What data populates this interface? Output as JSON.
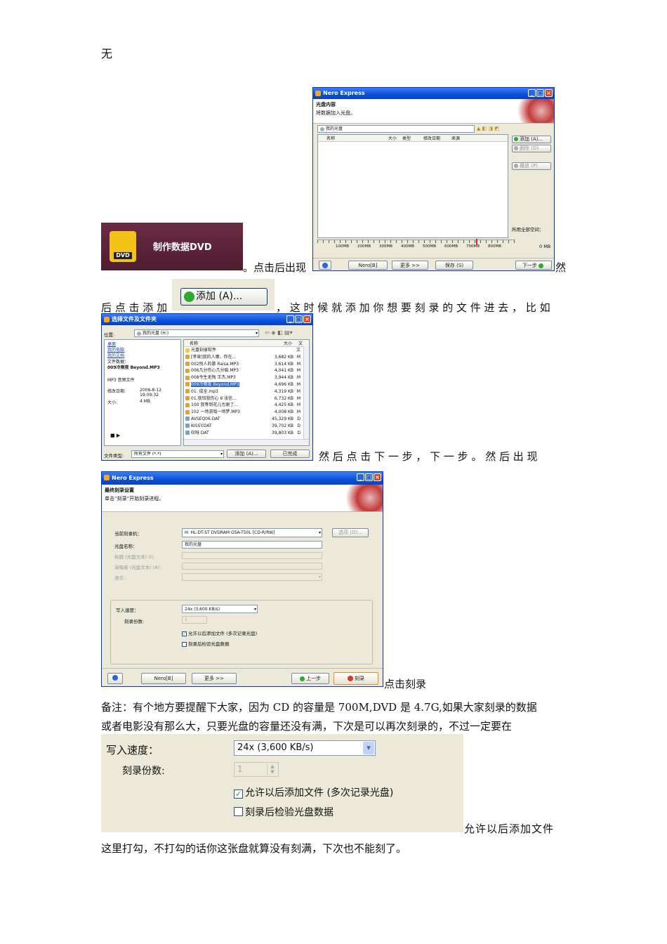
{
  "doc": {
    "line_top": "无",
    "after_dvd": "。点击后出现",
    "after_nero1": "然",
    "line_add_pre": "后 点 击 添 加",
    "line_add_post": "， 这 时 候 就 添 加 你 想 要 刻 录 的 文 件 进 去 ， 比 如",
    "after_filedlg": "然 后 点 击 下 一 步 ， 下 一 步 。 然 后 出 现",
    "after_burn": "点击刻录",
    "note_line1": "备注：有个地方要提醒下大家，因为 CD 的容量是 700M,DVD 是 4.7G,如果大家刻录的数据",
    "note_line2": "或者电影没有那么大，只要光盘的容量还没有满，下次是可以再次刻录的，不过一定要在",
    "after_zoom": "允许以后添加文件",
    "last_line": "这里打勾，不打勾的话你这张盘就算没有刻满，下次也不能刻了。"
  },
  "dvd_banner": {
    "label": "制作数据DVD",
    "badge": "DVD"
  },
  "nero1": {
    "title": "Nero Express",
    "header_title": "光盘内容",
    "header_sub": "将数据加入光盘。",
    "disc_name": "我的光盘",
    "columns": [
      "名称",
      "大小",
      "类型",
      "修改日期",
      "来源"
    ],
    "side_buttons": [
      "添加 (A)...",
      "删除 (D)",
      "播放 (P)"
    ],
    "total_space_label": "所用全部空间：",
    "total_space_value": "0 MB",
    "ruler": [
      "100MB",
      "200MB",
      "300MB",
      "400MB",
      "500MB",
      "600MB",
      "700MB",
      "800MB"
    ],
    "bottom_buttons": [
      "Nero[B]",
      "更多 >>",
      "保存 (S)",
      "下一步"
    ]
  },
  "add_button_zoom": {
    "label": "添加 (A)..."
  },
  "file_dialog": {
    "title": "选择文件及文件夹",
    "location_label": "位置:",
    "location_value": "我的光盘 (H:)",
    "left_links": [
      "桌面",
      "我的电脑",
      "我的文档"
    ],
    "info": {
      "file_data_label": "文件数据：",
      "file_name": "009冷雨夜 Beyond.MP3",
      "file_type": "MP3 音频文件",
      "modified_label": "修改日期:",
      "modified_value": "2006-8-12",
      "modified_time": "19:09:32",
      "size_label": "大小:",
      "size_value": "4 MB"
    },
    "columns": [
      "名称",
      "大小",
      "文"
    ],
    "files": [
      {
        "name": "光盘刻录软件",
        "size": "",
        "t": "文"
      },
      {
        "name": "[李泉]我的人哪，你在...",
        "size": "3,682 KB",
        "t": "M"
      },
      {
        "name": "002别人的歌 Raisa.MP3",
        "size": "3,614 KB",
        "t": "M"
      },
      {
        "name": "006几分伤心几分痴.MP3",
        "size": "4,041 KB",
        "t": "M"
      },
      {
        "name": "008今生无悔 王杰.MP3",
        "size": "3,944 KB",
        "t": "M"
      },
      {
        "name": "009冷雨夜 Beyond.MP3",
        "size": "4,696 KB",
        "t": "M"
      },
      {
        "name": "01. 成全.mp3",
        "size": "4,319 KB",
        "t": "M"
      },
      {
        "name": "01.我怕我伤心 6 张信...",
        "size": "6,732 KB",
        "t": "M"
      },
      {
        "name": "100 我等到花儿也谢了...",
        "size": "4,425 KB",
        "t": "M"
      },
      {
        "name": "102 一场游戏一场梦.MP3",
        "size": "4,008 KB",
        "t": "M"
      },
      {
        "name": "AVSEQ06.DAT",
        "size": "45,329 KB",
        "t": "D"
      },
      {
        "name": "KISSY.DAT",
        "size": "39,702 KB",
        "t": "D"
      },
      {
        "name": "叹呀.DAT",
        "size": "39,803 KB",
        "t": "D"
      }
    ],
    "filetype_label": "文件类型:",
    "filetype_value": "所有文件 (*.*)",
    "add_button": "添加 (A)...",
    "done_button": "已完成",
    "play_controls": "■ ▶"
  },
  "nero2": {
    "title": "Nero Express",
    "header_title": "最终刻录设置",
    "header_sub": "单击“刻录”开始刻录进程。",
    "recorder_label": "当前刻录机：",
    "recorder_value": "H: HL-DT-ST DVDRAM GSA-T50L    [CD-R/RW]",
    "options_button": "选项 (O)...",
    "disc_name_label": "光盘名称：",
    "disc_name_value": "我的光盘",
    "title_label": "标题 (光盘文本)  (I):",
    "artist_label": "演唱者 (光盘文本)  (A):",
    "lang_label": "语言:",
    "speed_label": "写入速度：",
    "speed_value": "24x (3,600 KB/s)",
    "copies_label": "刻录份数:",
    "copies_value": "1",
    "check1": "允许以后添加文件 (多次记录光盘)",
    "check2": "刻录后检验光盘数据",
    "bottom_buttons": [
      "Nero[B]",
      "更多 >>",
      "上一步",
      "刻录"
    ]
  },
  "zoom": {
    "speed_label": "写入速度：",
    "speed_value": "24x (3,600 KB/s)",
    "copies_label": "刻录份数:",
    "copies_value": "1",
    "check1": "允许以后添加文件 (多次记录光盘)",
    "check2": "刻录后检验光盘数据"
  }
}
